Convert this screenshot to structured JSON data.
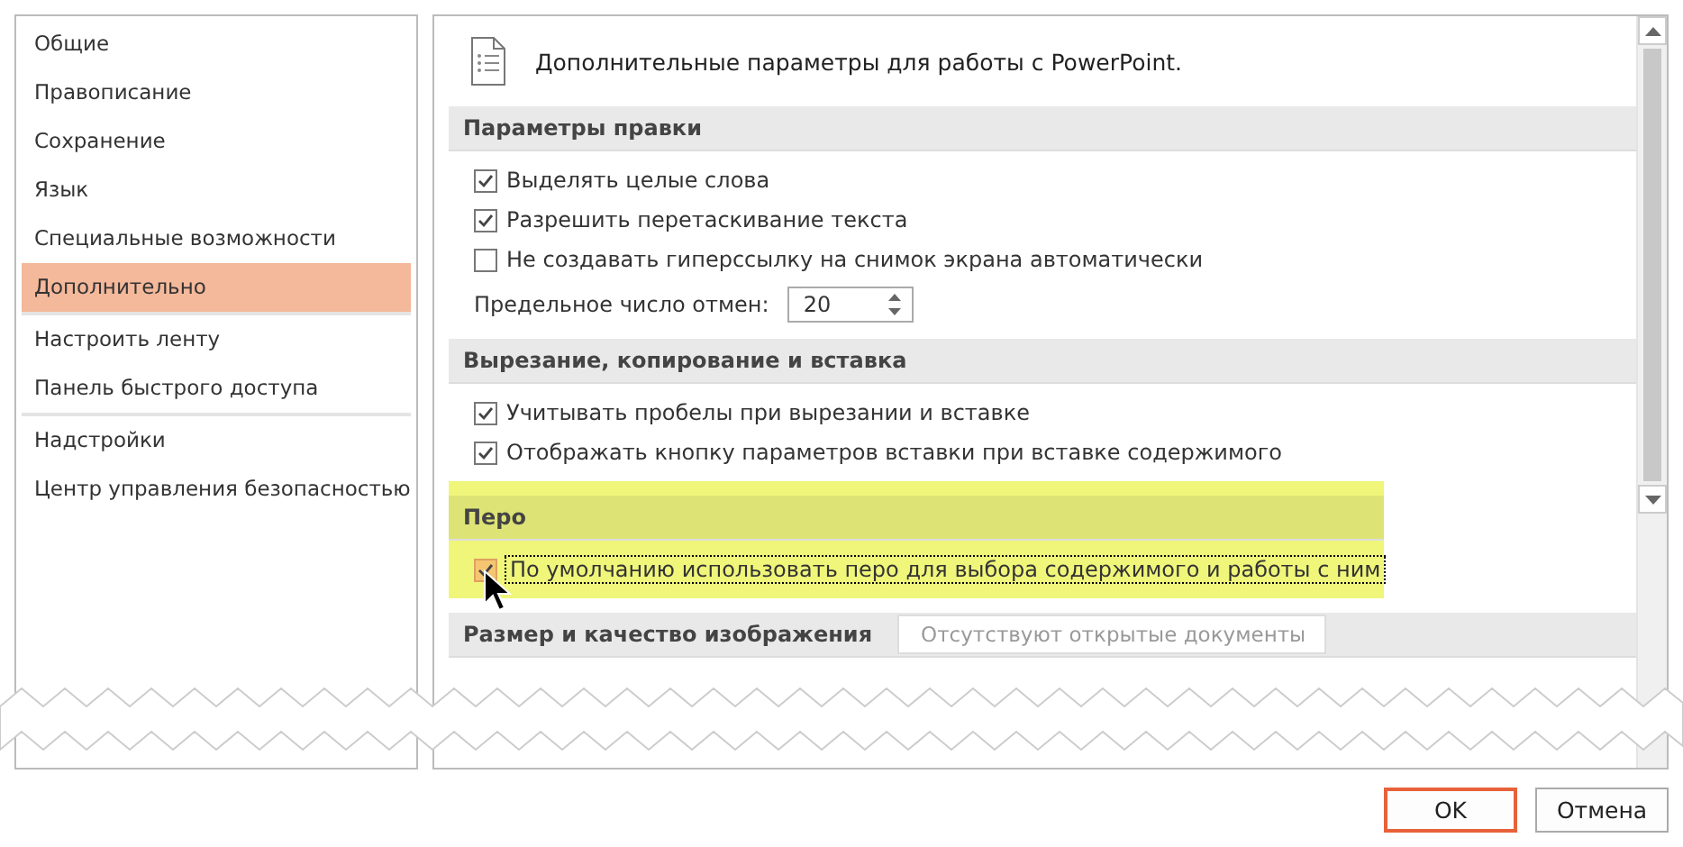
{
  "sidebar": {
    "items": [
      {
        "label": "Общие",
        "selected": false,
        "divider_after": false
      },
      {
        "label": "Правописание",
        "selected": false,
        "divider_after": false
      },
      {
        "label": "Сохранение",
        "selected": false,
        "divider_after": false
      },
      {
        "label": "Язык",
        "selected": false,
        "divider_after": false
      },
      {
        "label": "Специальные возможности",
        "selected": false,
        "divider_after": false
      },
      {
        "label": "Дополнительно",
        "selected": true,
        "divider_after": true
      },
      {
        "label": "Настроить ленту",
        "selected": false,
        "divider_after": false
      },
      {
        "label": "Панель быстрого доступа",
        "selected": false,
        "divider_after": true
      },
      {
        "label": "Надстройки",
        "selected": false,
        "divider_after": false
      },
      {
        "label": "Центр управления безопасностью",
        "selected": false,
        "divider_after": false
      }
    ]
  },
  "content": {
    "heading": "Дополнительные параметры для работы с PowerPoint.",
    "sections": [
      {
        "title": "Параметры правки",
        "highlighted": false,
        "items": [
          {
            "kind": "checkbox",
            "label": "Выделять целые слова",
            "checked": true,
            "focused": false
          },
          {
            "kind": "checkbox",
            "label": "Разрешить перетаскивание текста",
            "checked": true,
            "focused": false
          },
          {
            "kind": "checkbox",
            "label": "Не создавать гиперссылку на снимок экрана автоматически",
            "checked": false,
            "focused": false
          },
          {
            "kind": "spinner",
            "label": "Предельное число отмен:",
            "value": "20"
          }
        ]
      },
      {
        "title": "Вырезание, копирование и вставка",
        "highlighted": false,
        "items": [
          {
            "kind": "checkbox",
            "label": "Учитывать пробелы при вырезании и вставке",
            "checked": true,
            "focused": false
          },
          {
            "kind": "checkbox",
            "label": "Отображать кнопку параметров вставки при вставке содержимого",
            "checked": true,
            "focused": false
          }
        ]
      },
      {
        "title": "Перо",
        "highlighted": true,
        "items": [
          {
            "kind": "checkbox",
            "label": "По умолчанию использовать перо для выбора содержимого и работы с ним",
            "checked": true,
            "focused": true
          }
        ]
      },
      {
        "title": "Размер и качество изображения",
        "highlighted": false,
        "dropdown": {
          "value": "Отсутствуют открытые документы",
          "disabled": true
        }
      }
    ]
  },
  "buttons": [
    {
      "label": "OK",
      "default": true
    },
    {
      "label": "Отмена",
      "default": false
    }
  ]
}
